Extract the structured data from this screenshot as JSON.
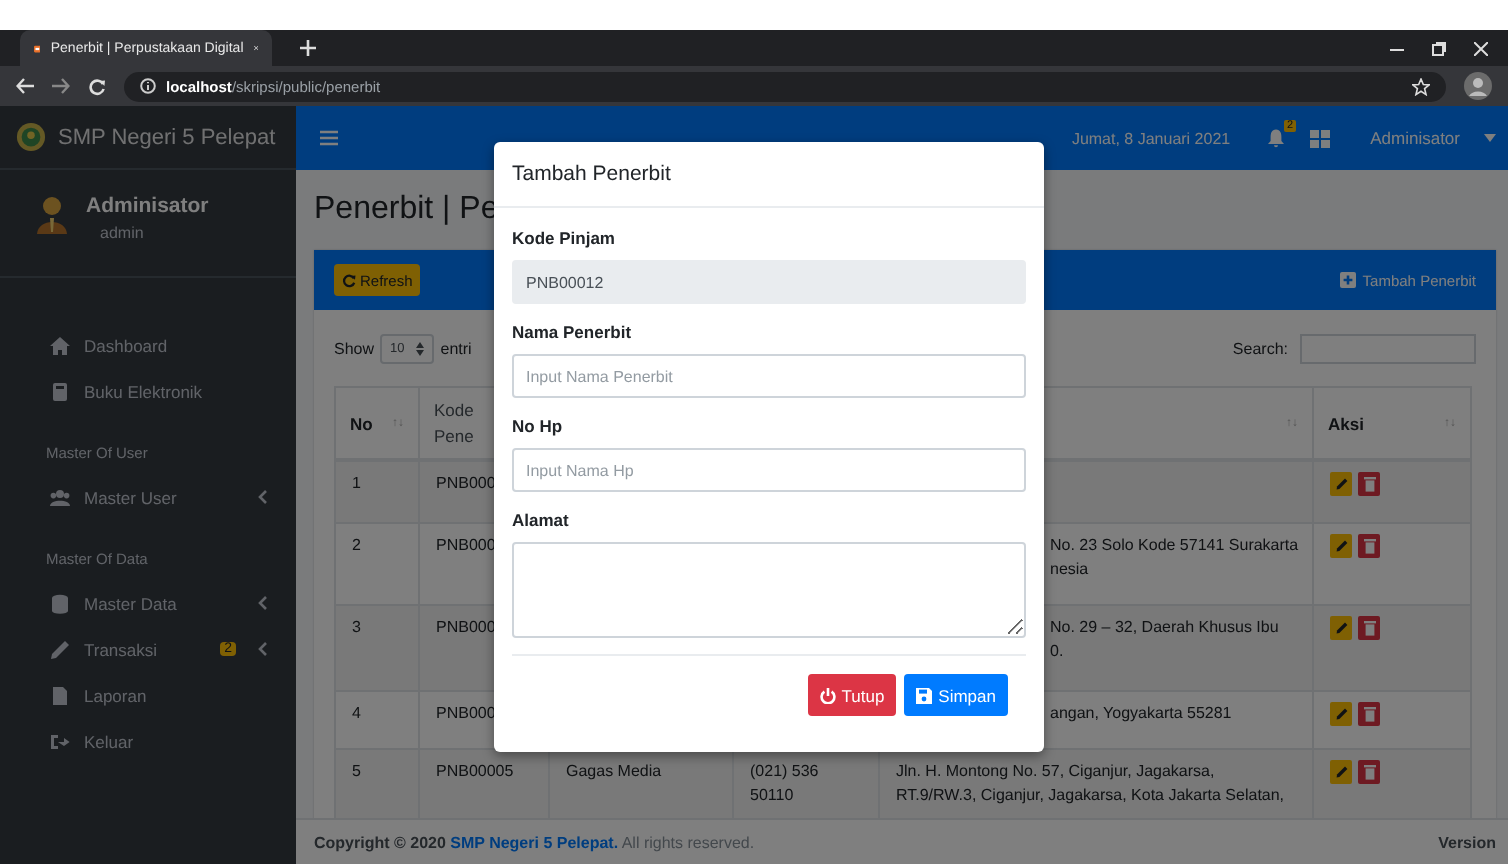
{
  "browser": {
    "tab_title": "Penerbit | Perpustakaan Digital",
    "url_host": "localhost",
    "url_path": "/skripsi/public/penerbit"
  },
  "sidebar": {
    "brand": "SMP Negeri 5 Pelepat",
    "user_name": "Adminisator",
    "user_role": "admin",
    "items": [
      {
        "kind": "link",
        "label": "Dashboard",
        "expandable": false
      },
      {
        "kind": "link",
        "label": "Buku Elektronik",
        "expandable": false
      },
      {
        "kind": "header",
        "label": "Master Of User"
      },
      {
        "kind": "link",
        "label": "Master User",
        "expandable": true
      },
      {
        "kind": "header",
        "label": "Master Of Data"
      },
      {
        "kind": "link",
        "label": "Master Data",
        "expandable": true
      },
      {
        "kind": "link",
        "label": "Transaksi",
        "expandable": true,
        "badge": "2"
      },
      {
        "kind": "link",
        "label": "Laporan",
        "expandable": false
      },
      {
        "kind": "link",
        "label": "Keluar",
        "expandable": false
      }
    ]
  },
  "navbar": {
    "date": "Jumat, 8 Januari 2021",
    "notification_count": "2",
    "user": "Adminisator"
  },
  "content": {
    "page_title": "Penerbit | Pe",
    "refresh_button": "Refresh",
    "add_button": "Tambah Penerbit",
    "show_label": "Show",
    "entries_value": "10",
    "entries_label": "entri",
    "search_label": "Search:"
  },
  "table": {
    "columns": [
      {
        "label": "No",
        "sort_icon": "↑↓"
      },
      {
        "label": "Kode Pene"
      },
      {},
      {},
      {
        "sort_icon": "↑↓"
      },
      {
        "label": "Aksi",
        "sort_icon": "↑↓"
      }
    ],
    "rows": [
      {
        "no": "1",
        "kode": "PNB000"
      },
      {
        "no": "2",
        "kode": "PNB000",
        "alamat": [
          "No. 23 Solo Kode 57141 Surakarta",
          "nesia"
        ]
      },
      {
        "no": "3",
        "kode": "PNB000",
        "alamat": [
          "No. 29 – 32, Daerah Khusus Ibu",
          "0."
        ]
      },
      {
        "no": "4",
        "kode": "PNB000",
        "alamat": [
          "angan, Yogyakarta 55281"
        ]
      },
      {
        "no": "5",
        "kode": "PNB00005",
        "nama": "Gagas Media",
        "hp": [
          "(021) 536",
          "50110"
        ],
        "alamat": [
          "Jln. H. Montong No. 57, Ciganjur, Jagakarsa,",
          "RT.9/RW.3, Ciganjur, Jagakarsa, Kota Jakarta Selatan,"
        ]
      }
    ]
  },
  "footer": {
    "prefix": "Copyright © 2020",
    "link": "SMP Negeri 5 Pelepat.",
    "suffix": "All rights reserved.",
    "version": "Version"
  },
  "modal": {
    "title": "Tambah Penerbit",
    "fields": [
      {
        "kind": "input",
        "label": "Kode Pinjam",
        "value": "PNB00012",
        "disabled": true
      },
      {
        "kind": "input",
        "label": "Nama Penerbit",
        "placeholder": "Input Nama Penerbit",
        "disabled": false
      },
      {
        "kind": "input",
        "label": "No Hp",
        "placeholder": "Input Nama Hp",
        "disabled": false
      },
      {
        "kind": "textarea",
        "label": "Alamat",
        "disabled": false
      }
    ],
    "buttons": [
      {
        "kind": "danger",
        "label": "Tutup"
      },
      {
        "kind": "primary",
        "label": "Simpan"
      }
    ]
  }
}
